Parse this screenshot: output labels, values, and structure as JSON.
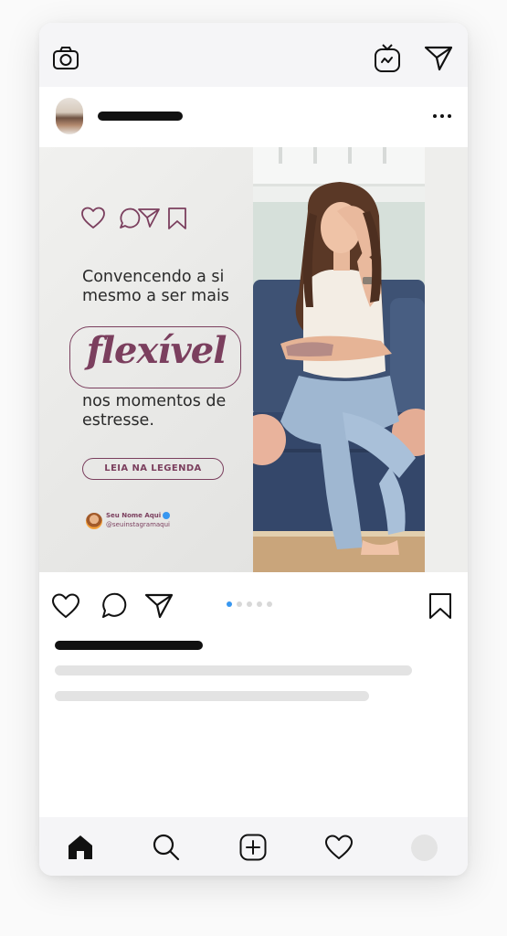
{
  "app": {
    "name": "Instagram post mockup"
  },
  "top_bar": {
    "icons": [
      "camera-icon",
      "igtv-icon",
      "direct-message-icon"
    ]
  },
  "post_header": {
    "more_icon": "more-horizontal-icon"
  },
  "post": {
    "mini_icons": [
      "heart-icon",
      "comment-icon",
      "share-icon",
      "bookmark-icon"
    ],
    "headline": "Convencendo a si mesmo a ser mais",
    "highlight_word": "flexível",
    "subheadline": "nos momentos de estresse.",
    "cta_label": "LEIA NA LEGENDA",
    "credit": {
      "name": "Seu Nome Aqui",
      "handle": "@seuinstagramaqui"
    },
    "colors": {
      "accent": "#7b3f5e",
      "text": "#2a2a2a",
      "sofa": "#3e5274"
    }
  },
  "actions": {
    "icons": [
      "heart-icon",
      "comment-icon",
      "share-icon",
      "bookmark-icon"
    ],
    "carousel": {
      "total": 5,
      "active": 1,
      "active_color": "#3897f0"
    }
  },
  "bottom_nav": {
    "items": [
      "home-icon",
      "search-icon",
      "new-post-icon",
      "activity-icon",
      "profile-avatar"
    ]
  }
}
